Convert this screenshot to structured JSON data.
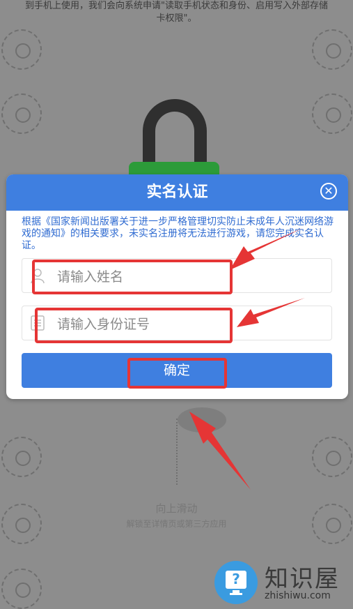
{
  "background": {
    "top_text_line1": "到手机上使用，我们会向系统申请\"读取手机状态和身份、启用写入外部存储",
    "top_text_line2": "卡权限\"。",
    "swipe_label": "向上滑动",
    "swipe_sublabel": "解锁至详情页或第三方应用"
  },
  "dialog": {
    "title": "实名认证",
    "close_icon": "close-circle-icon",
    "notice": "根据《国家新闻出版署关于进一步严格管理切实防止未成年人沉迷网络游戏的通知》的相关要求，未实名注册将无法进行游戏，请您完成实名认证。",
    "name_placeholder": "请输入姓名",
    "id_placeholder": "请输入身份证号",
    "confirm_label": "确定"
  },
  "watermark": {
    "title": "知识屋",
    "subtitle": "zhishiwu.com",
    "icon_glyph": "?"
  },
  "colors": {
    "accent": "#3f7fe0",
    "highlight": "#e53535",
    "backdrop": "#8d8d8d"
  }
}
